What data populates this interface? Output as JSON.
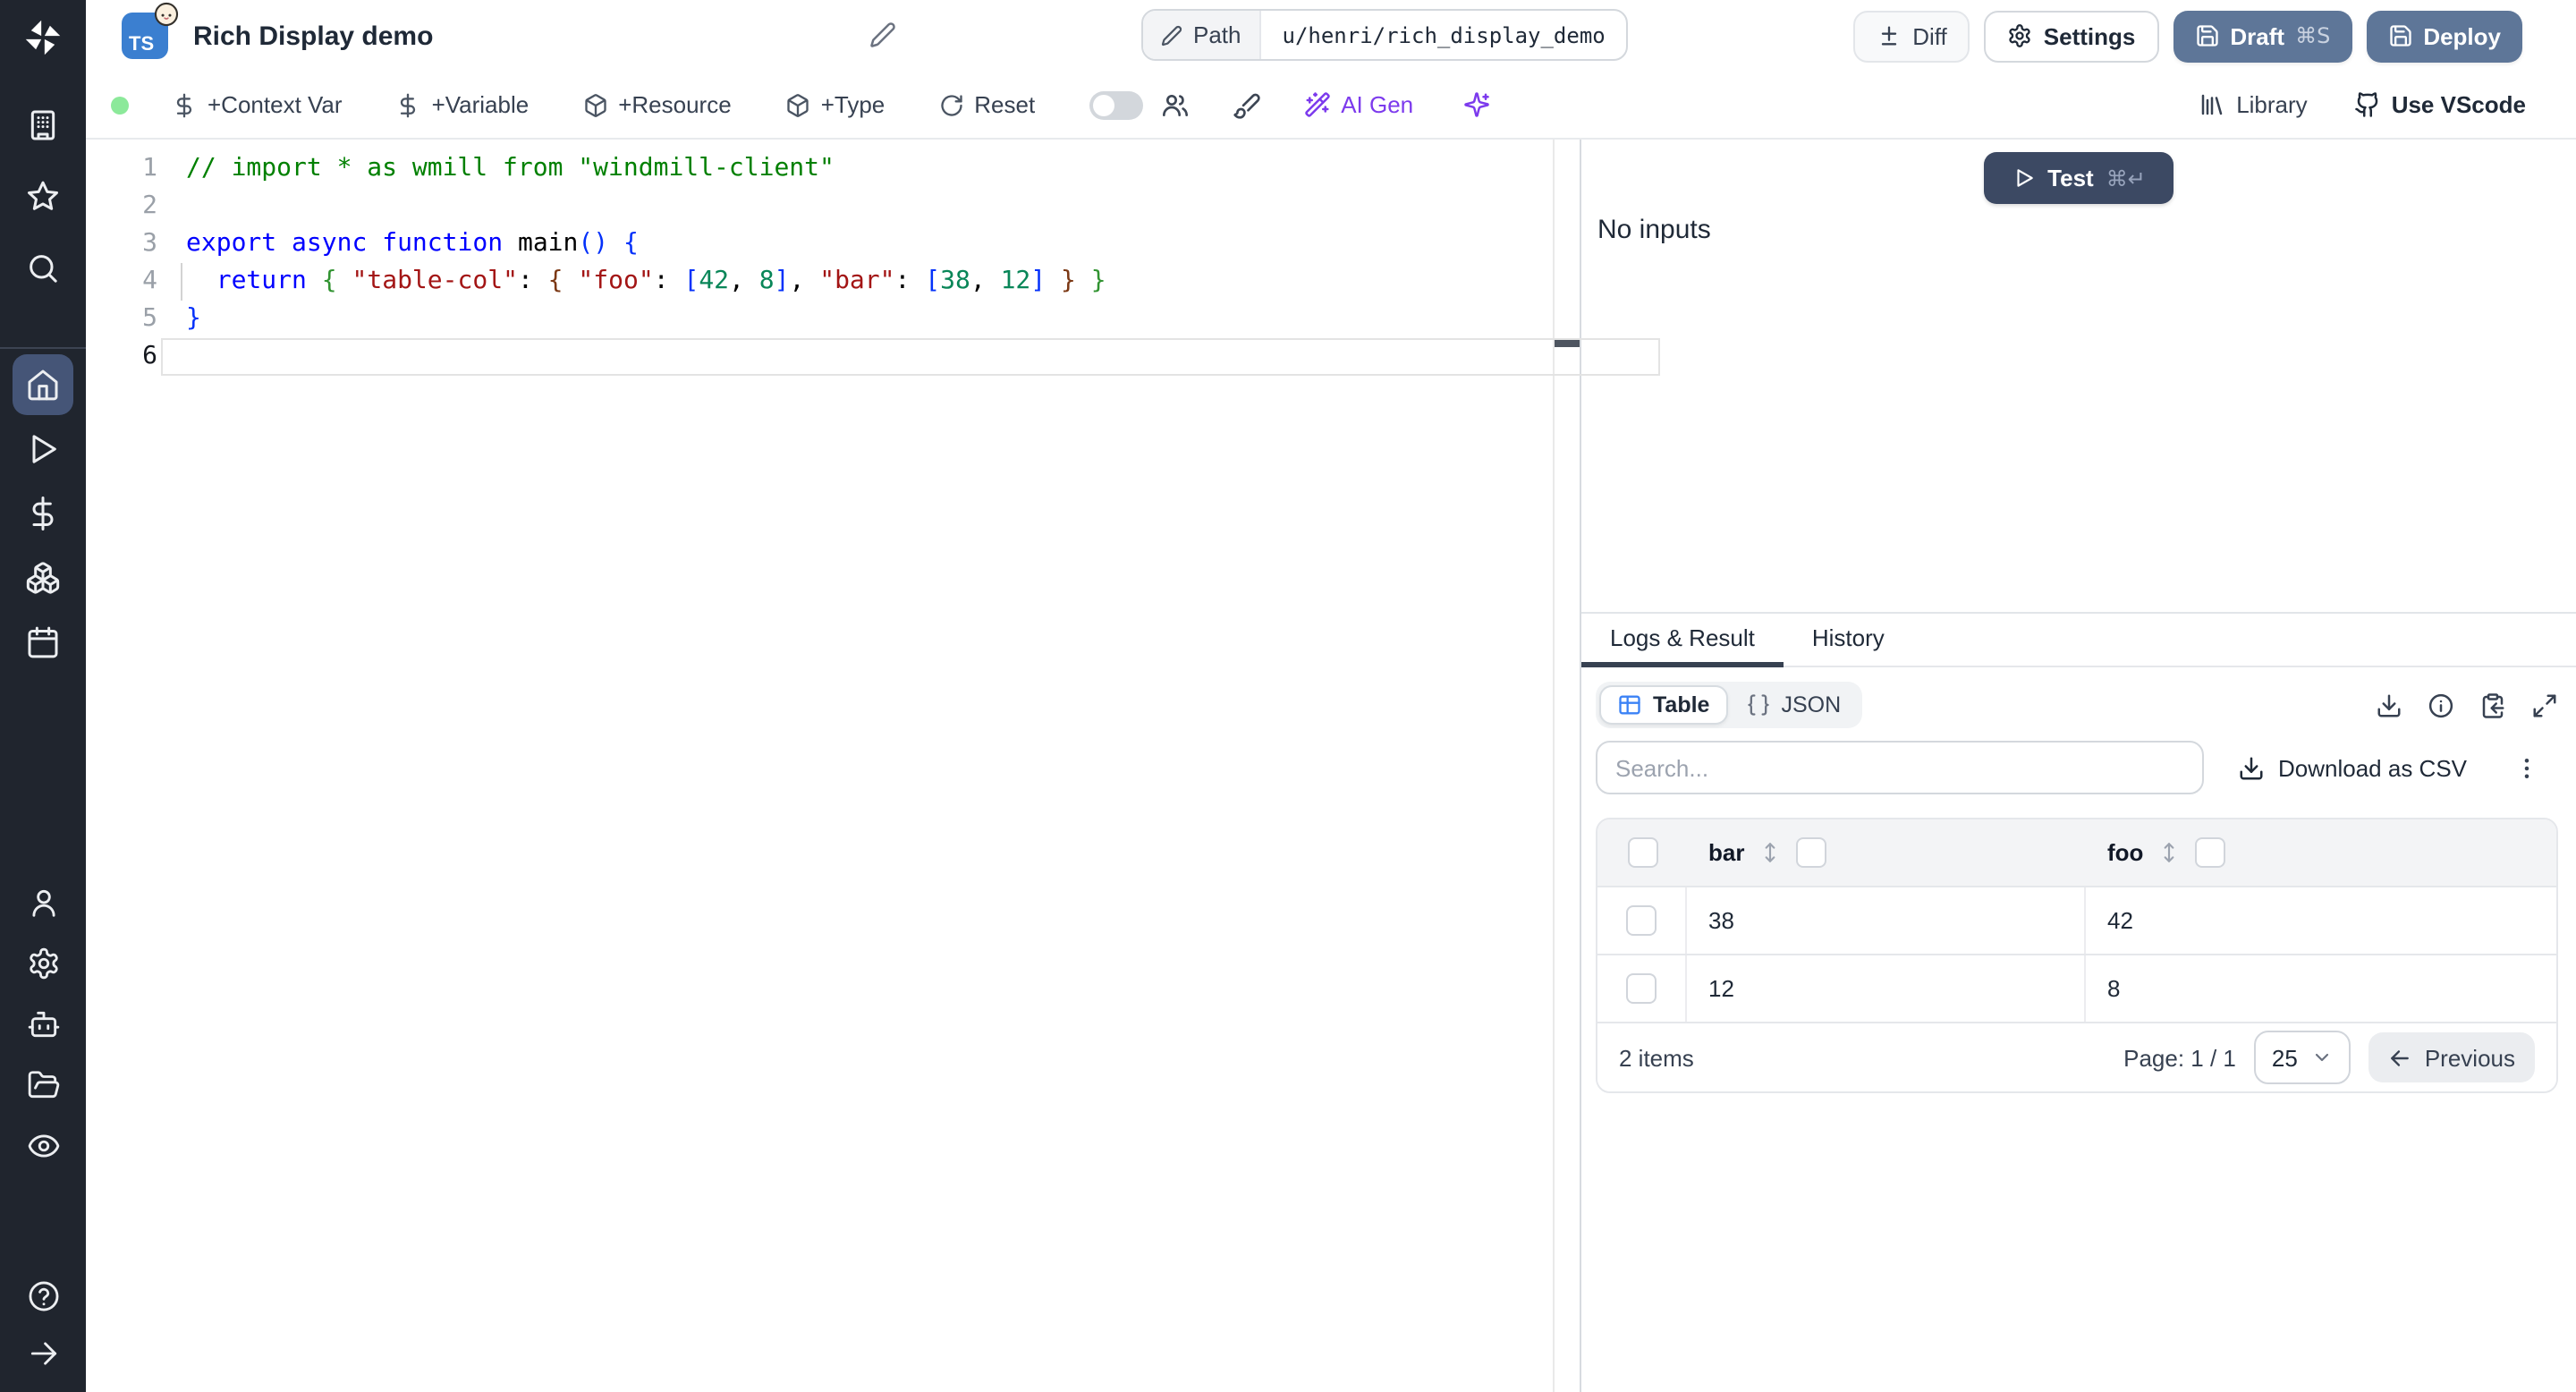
{
  "colors": {
    "sidebar_bg": "#20252e",
    "sidebar_active_bg": "#455577",
    "slate_button_bg": "#5e7698",
    "test_button_bg": "#3c4963",
    "accent_blue": "#3b82f6",
    "ai_purple": "#7c3aed",
    "status_green": "#8ce99a",
    "ts_badge_bg": "#3b7fd0"
  },
  "sidebar": {
    "logo_icon": "windmill-logo",
    "groups": [
      {
        "items": [
          {
            "icon": "building",
            "name": "workspace"
          },
          {
            "icon": "star",
            "name": "favorites"
          },
          {
            "icon": "search",
            "name": "search"
          }
        ]
      },
      {
        "items": [
          {
            "icon": "home",
            "name": "home",
            "active": true
          },
          {
            "icon": "play",
            "name": "runs"
          },
          {
            "icon": "dollar",
            "name": "variables"
          },
          {
            "icon": "boxes",
            "name": "resources"
          },
          {
            "icon": "calendar",
            "name": "schedules"
          }
        ]
      },
      {
        "items": [
          {
            "icon": "user",
            "name": "users"
          },
          {
            "icon": "gear",
            "name": "settings"
          },
          {
            "icon": "robot",
            "name": "workers"
          },
          {
            "icon": "folder-open",
            "name": "folders"
          },
          {
            "icon": "eye",
            "name": "audit-logs"
          }
        ]
      },
      {
        "items": [
          {
            "icon": "help-circle",
            "name": "help"
          },
          {
            "icon": "arrow-right",
            "name": "expand-sidebar"
          }
        ]
      }
    ]
  },
  "header": {
    "language_badge": "TS",
    "title": "Rich Display demo",
    "path_label": "Path",
    "path_value": "u/henri/rich_display_demo",
    "diff_label": "Diff",
    "settings_label": "Settings",
    "draft_label": "Draft",
    "draft_shortcut": "⌘S",
    "deploy_label": "Deploy"
  },
  "toolbar": {
    "context_var_label": "+Context Var",
    "variable_label": "+Variable",
    "resource_label": "+Resource",
    "type_label": "+Type",
    "reset_label": "Reset",
    "ai_gen_label": "AI Gen",
    "library_label": "Library",
    "vscode_label": "Use VScode"
  },
  "editor": {
    "token_colors": {
      "comment": "#008000",
      "keyword": "#0000ff",
      "string": "#a31515",
      "number": "#098658",
      "b1": "#0431fa",
      "b2": "#319331",
      "b3": "#7b3814",
      "plain": "#000000"
    },
    "lines": [
      {
        "tokens": [
          [
            "// import * as wmill from \"windmill-client\"",
            "comment"
          ]
        ]
      },
      {
        "tokens": []
      },
      {
        "tokens": [
          [
            "export",
            "keyword"
          ],
          [
            " ",
            "plain"
          ],
          [
            "async",
            "keyword"
          ],
          [
            " ",
            "plain"
          ],
          [
            "function",
            "keyword"
          ],
          [
            " ",
            "plain"
          ],
          [
            "main",
            "plain"
          ],
          [
            "(",
            "b1"
          ],
          [
            ")",
            "b1"
          ],
          [
            " ",
            "plain"
          ],
          [
            "{",
            "b1"
          ]
        ]
      },
      {
        "tokens": [
          [
            "  ",
            "plain"
          ],
          [
            "return",
            "keyword"
          ],
          [
            " ",
            "plain"
          ],
          [
            "{",
            "b2"
          ],
          [
            " ",
            "plain"
          ],
          [
            "\"table-col\"",
            "string"
          ],
          [
            ": ",
            "plain"
          ],
          [
            "{",
            "b3"
          ],
          [
            " ",
            "plain"
          ],
          [
            "\"foo\"",
            "string"
          ],
          [
            ": ",
            "plain"
          ],
          [
            "[",
            "b1"
          ],
          [
            "42",
            "number"
          ],
          [
            ", ",
            "plain"
          ],
          [
            "8",
            "number"
          ],
          [
            "]",
            "b1"
          ],
          [
            ", ",
            "plain"
          ],
          [
            "\"bar\"",
            "string"
          ],
          [
            ": ",
            "plain"
          ],
          [
            "[",
            "b1"
          ],
          [
            "38",
            "number"
          ],
          [
            ", ",
            "plain"
          ],
          [
            "12",
            "number"
          ],
          [
            "]",
            "b1"
          ],
          [
            " ",
            "plain"
          ],
          [
            "}",
            "b3"
          ],
          [
            " ",
            "plain"
          ],
          [
            "}",
            "b2"
          ]
        ],
        "indent_guide": true
      },
      {
        "tokens": [
          [
            "}",
            "b1"
          ]
        ]
      },
      {
        "tokens": [],
        "current": true
      }
    ]
  },
  "run_panel": {
    "test_label": "Test",
    "test_shortcut": "⌘↵",
    "no_inputs_text": "No inputs",
    "tabs": [
      {
        "label": "Logs & Result",
        "active": true
      },
      {
        "label": "History",
        "active": false
      }
    ],
    "view_toggle": {
      "table_label": "Table",
      "json_label": "JSON"
    },
    "search_placeholder": "Search...",
    "download_csv_label": "Download as CSV",
    "table": {
      "columns": [
        "bar",
        "foo"
      ],
      "rows": [
        [
          "38",
          "42"
        ],
        [
          "12",
          "8"
        ]
      ],
      "items_count_label": "2 items",
      "page_label": "Page: 1 / 1",
      "page_size": "25",
      "previous_label": "Previous"
    }
  }
}
